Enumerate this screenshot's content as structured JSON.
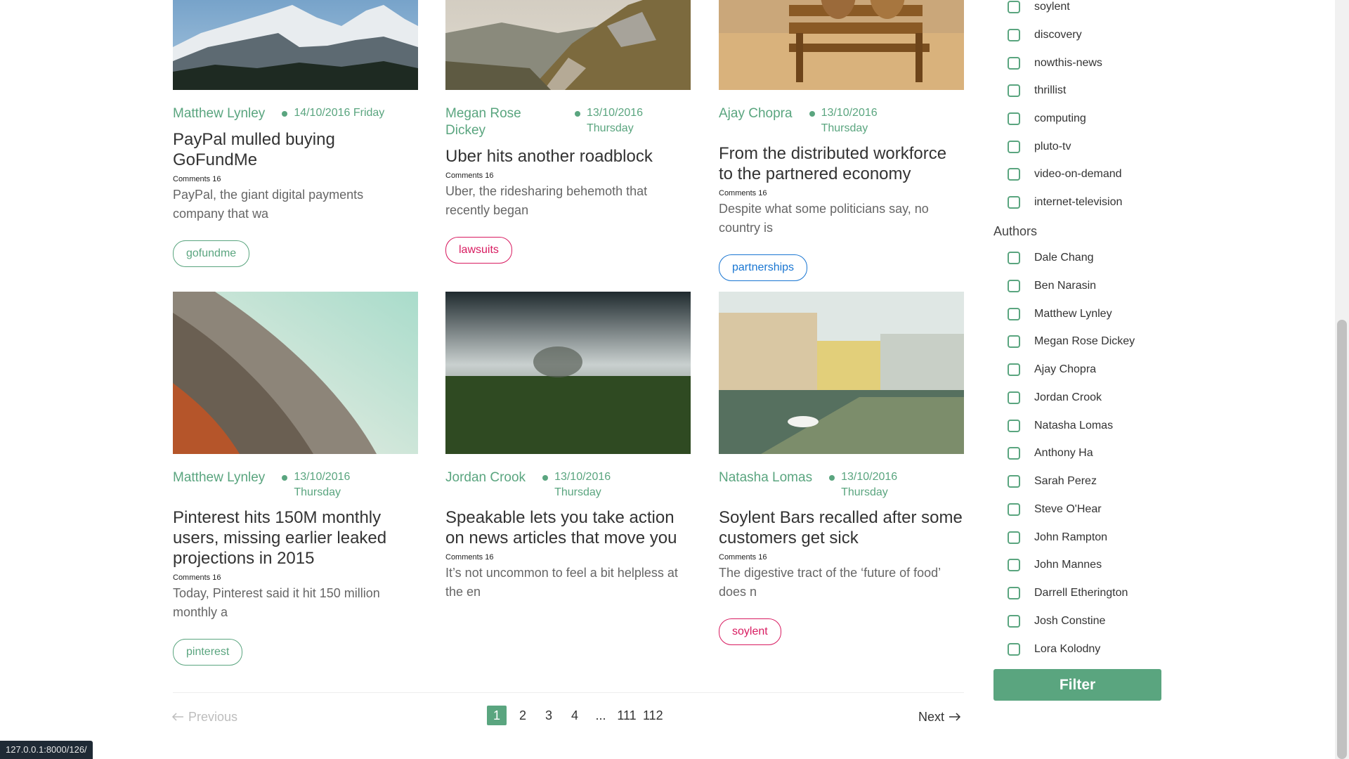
{
  "articles": [
    {
      "author": "Matthew Lynley",
      "date": "14/10/2016 Friday",
      "title": "PayPal mulled buying GoFundMe",
      "comments": "Comments 16",
      "excerpt": "PayPal, the giant digital payments company that wa",
      "tag": "gofundme",
      "tag_color": "#5aa57f",
      "image": "mountain-photo"
    },
    {
      "author": "Megan Rose Dickey",
      "date": "13/10/2016 Thursday",
      "title": "Uber hits another roadblock",
      "comments": "Comments 16",
      "excerpt": "Uber, the ridesharing behemoth that recently began",
      "tag": "lawsuits",
      "tag_color": "#d81b60",
      "image": "hillside-path-photo"
    },
    {
      "author": "Ajay Chopra",
      "date": "13/10/2016 Thursday",
      "title": "From the distributed workforce to the partnered economy",
      "comments": "Comments 16",
      "excerpt": "Despite what some politicians say, no country is",
      "tag": "partnerships",
      "tag_color": "#1976d2",
      "image": "bench-beach-photo"
    },
    {
      "author": "Matthew Lynley",
      "date": "13/10/2016 Thursday",
      "title": "Pinterest hits 150M monthly users, missing earlier leaked projections in 2015",
      "comments": "Comments 16",
      "excerpt": "Today, Pinterest said it hit 150 million monthly a",
      "tag": "pinterest",
      "tag_color": "#5aa57f",
      "image": "architecture-curve-photo"
    },
    {
      "author": "Jordan Crook",
      "date": "13/10/2016 Thursday",
      "title": "Speakable lets you take action on news articles that move you",
      "comments": "Comments 16",
      "excerpt": "It’s not uncommon to feel a bit helpless at the en",
      "image": "foggy-field-photo"
    },
    {
      "author": "Natasha Lomas",
      "date": "13/10/2016 Thursday",
      "title": "Soylent Bars recalled after some customers get sick",
      "comments": "Comments 16",
      "excerpt": "The digestive tract of the ‘future of food’ does n",
      "tag": "soylent",
      "tag_color": "#d81b60",
      "image": "canal-town-photo"
    }
  ],
  "sidebar": {
    "tags": [
      "soylent",
      "discovery",
      "nowthis-news",
      "thrillist",
      "computing",
      "pluto-tv",
      "video-on-demand",
      "internet-television"
    ],
    "authors_title": "Authors",
    "authors": [
      "Dale Chang",
      "Ben Narasin",
      "Matthew Lynley",
      "Megan Rose Dickey",
      "Ajay Chopra",
      "Jordan Crook",
      "Natasha Lomas",
      "Anthony Ha",
      "Sarah Perez",
      "Steve O'Hear",
      "John Rampton",
      "John Mannes",
      "Darrell Etherington",
      "Josh Constine",
      "Lora Kolodny"
    ],
    "filter_label": "Filter"
  },
  "pagination": {
    "previous": "Previous",
    "next": "Next",
    "pages": [
      "1",
      "2",
      "3",
      "4",
      "...",
      "111",
      "112"
    ],
    "current": "1"
  },
  "status_url": "127.0.0.1:8000/126/",
  "colors": {
    "accent": "#5aa57f",
    "tag_red": "#d81b60",
    "tag_blue": "#1976d2"
  }
}
